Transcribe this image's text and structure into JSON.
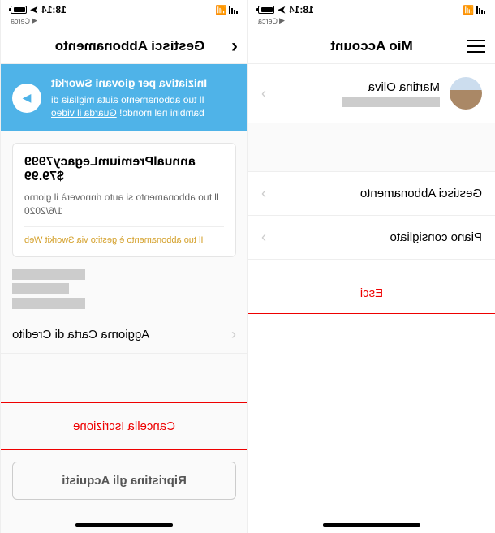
{
  "status": {
    "time": "18:14",
    "location_icon": "location-icon",
    "back_breadcrumb": "Cerca"
  },
  "left_screen": {
    "title": "Mio Account",
    "profile": {
      "name": "Martina Oliva"
    },
    "items": [
      {
        "label": "Gestisci Abbonamento"
      },
      {
        "label": "Piano consigliato"
      }
    ],
    "logout": "Esci"
  },
  "right_screen": {
    "title": "Gestisci Abbonamento",
    "banner": {
      "title": "Iniziativa per giovani Sworkit",
      "sub": "Il tuo abbonamento aiuta migliaia di bambini nel mondo! ",
      "link": "Guarda il video"
    },
    "card": {
      "plan": "annualPremiumLegacy7999",
      "price": "$79.99",
      "sub": "Il tuo abbonamento si auto rinnoverà il giorno 1/6/2020",
      "note": "Il tuo abbonamento è gestito via Sworkit Web"
    },
    "credit": "Aggiorna Carta di Credito",
    "cancel": "Cancella Iscrizione",
    "restore": "Ripristina gli Acquisti"
  }
}
